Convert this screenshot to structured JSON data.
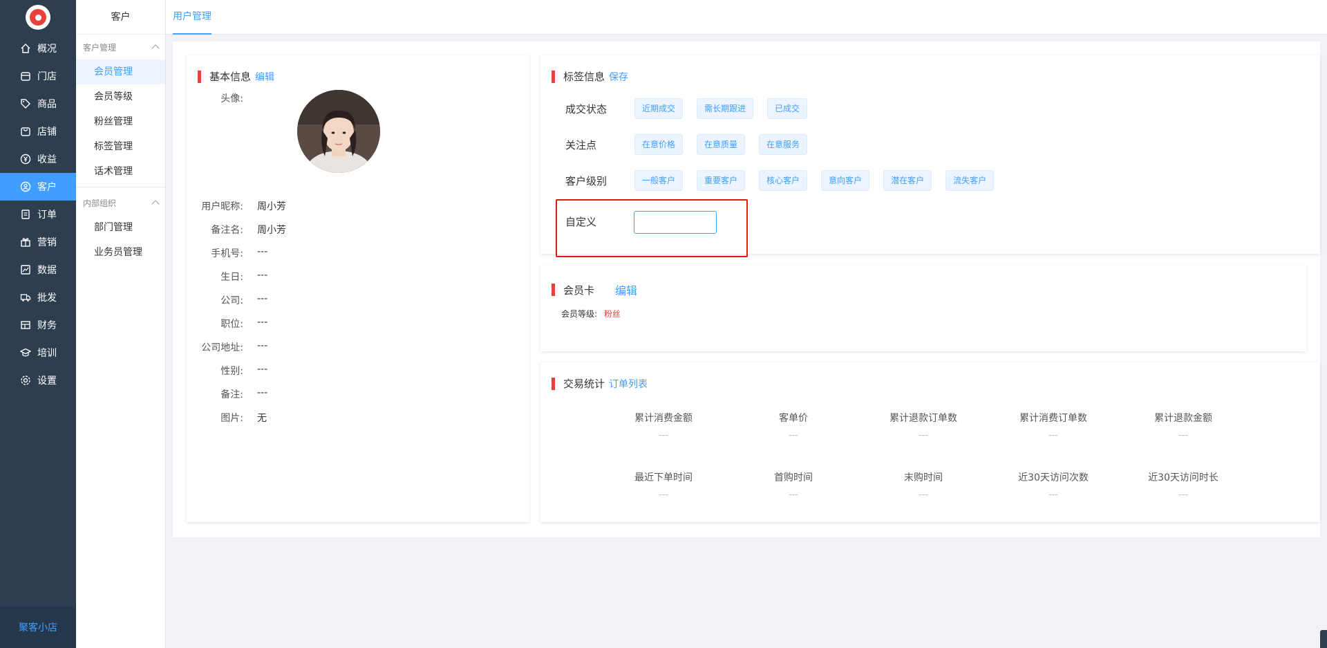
{
  "nav": {
    "items": [
      {
        "label": "概况",
        "icon": "home-icon"
      },
      {
        "label": "门店",
        "icon": "store-icon"
      },
      {
        "label": "商品",
        "icon": "tag-icon"
      },
      {
        "label": "店铺",
        "icon": "shop-bag-icon"
      },
      {
        "label": "收益",
        "icon": "yen-icon"
      },
      {
        "label": "客户",
        "icon": "user-icon",
        "active": true
      },
      {
        "label": "订单",
        "icon": "order-icon"
      },
      {
        "label": "营销",
        "icon": "gift-icon"
      },
      {
        "label": "数据",
        "icon": "chart-icon"
      },
      {
        "label": "批发",
        "icon": "truck-icon"
      },
      {
        "label": "财务",
        "icon": "finance-icon"
      },
      {
        "label": "培训",
        "icon": "training-icon"
      },
      {
        "label": "设置",
        "icon": "gear-icon"
      }
    ],
    "footer": "聚客小店"
  },
  "sub": {
    "title": "客户",
    "groups": [
      {
        "label": "客户管理",
        "items": [
          "会员管理",
          "会员等级",
          "粉丝管理",
          "标签管理",
          "话术管理"
        ]
      },
      {
        "label": "内部组织",
        "items": [
          "部门管理",
          "业务员管理"
        ]
      }
    ]
  },
  "tab": {
    "label": "用户管理"
  },
  "basic": {
    "title": "基本信息",
    "edit": "编辑",
    "avatar_label": "头像:",
    "fields": [
      {
        "label": "用户昵称:",
        "value": "周小芳"
      },
      {
        "label": "备注名:",
        "value": "周小芳"
      },
      {
        "label": "手机号:",
        "value": "---"
      },
      {
        "label": "生日:",
        "value": "---"
      },
      {
        "label": "公司:",
        "value": "---"
      },
      {
        "label": "职位:",
        "value": "---"
      },
      {
        "label": "公司地址:",
        "value": "---"
      },
      {
        "label": "性别:",
        "value": "---"
      },
      {
        "label": "备注:",
        "value": "---"
      },
      {
        "label": "图片:",
        "value": "无"
      }
    ]
  },
  "tags": {
    "title": "标签信息",
    "save": "保存",
    "rows": [
      {
        "label": "成交状态",
        "tags": [
          "近期成交",
          "需长期跟进",
          "已成交"
        ]
      },
      {
        "label": "关注点",
        "tags": [
          "在意价格",
          "在意质量",
          "在意服务"
        ]
      },
      {
        "label": "客户级别",
        "tags": [
          "一般客户",
          "重要客户",
          "核心客户",
          "意向客户",
          "潜在客户",
          "流失客户"
        ]
      }
    ],
    "custom_label": "自定义",
    "custom_value": ""
  },
  "member": {
    "title": "会员卡",
    "edit": "编辑",
    "level_label": "会员等级:",
    "level_value": "粉丝",
    "level_color": "#e8413b"
  },
  "trade": {
    "title": "交易统计",
    "link": "订单列表",
    "stats": [
      {
        "label": "累计消费金额",
        "value": "---"
      },
      {
        "label": "客单价",
        "value": "---"
      },
      {
        "label": "累计退款订单数",
        "value": "---"
      },
      {
        "label": "累计消费订单数",
        "value": "---"
      },
      {
        "label": "累计退款金额",
        "value": "---"
      },
      {
        "label": "最近下单时间",
        "value": "---"
      },
      {
        "label": "首购时间",
        "value": "---"
      },
      {
        "label": "末购时间",
        "value": "---"
      },
      {
        "label": "近30天访问次数",
        "value": "---"
      },
      {
        "label": "近30天访问时长",
        "value": "---"
      }
    ]
  },
  "colors": {
    "accent": "#409eff",
    "sidebar": "#2c3e50",
    "marker": "#e8413b"
  }
}
